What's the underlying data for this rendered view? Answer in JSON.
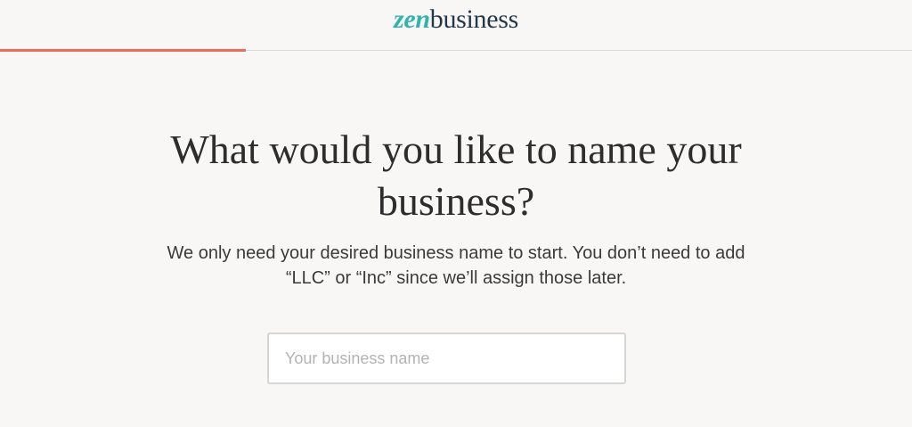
{
  "header": {
    "logo_zen": "zen",
    "logo_business": "business"
  },
  "progress": {
    "fraction": 0.27,
    "color": "#f06a5a"
  },
  "main": {
    "title": "What would you like to name your business?",
    "subtitle": "We only need your desired business name to start. You don’t need to add “LLC” or “Inc” since we’ll assign those later.",
    "business_name_input": {
      "value": "",
      "placeholder": "Your business name"
    }
  },
  "colors": {
    "background": "#f8f7f6",
    "brand_teal": "#2fb5ae",
    "brand_navy": "#22384a",
    "accent_coral": "#f06a5a"
  }
}
